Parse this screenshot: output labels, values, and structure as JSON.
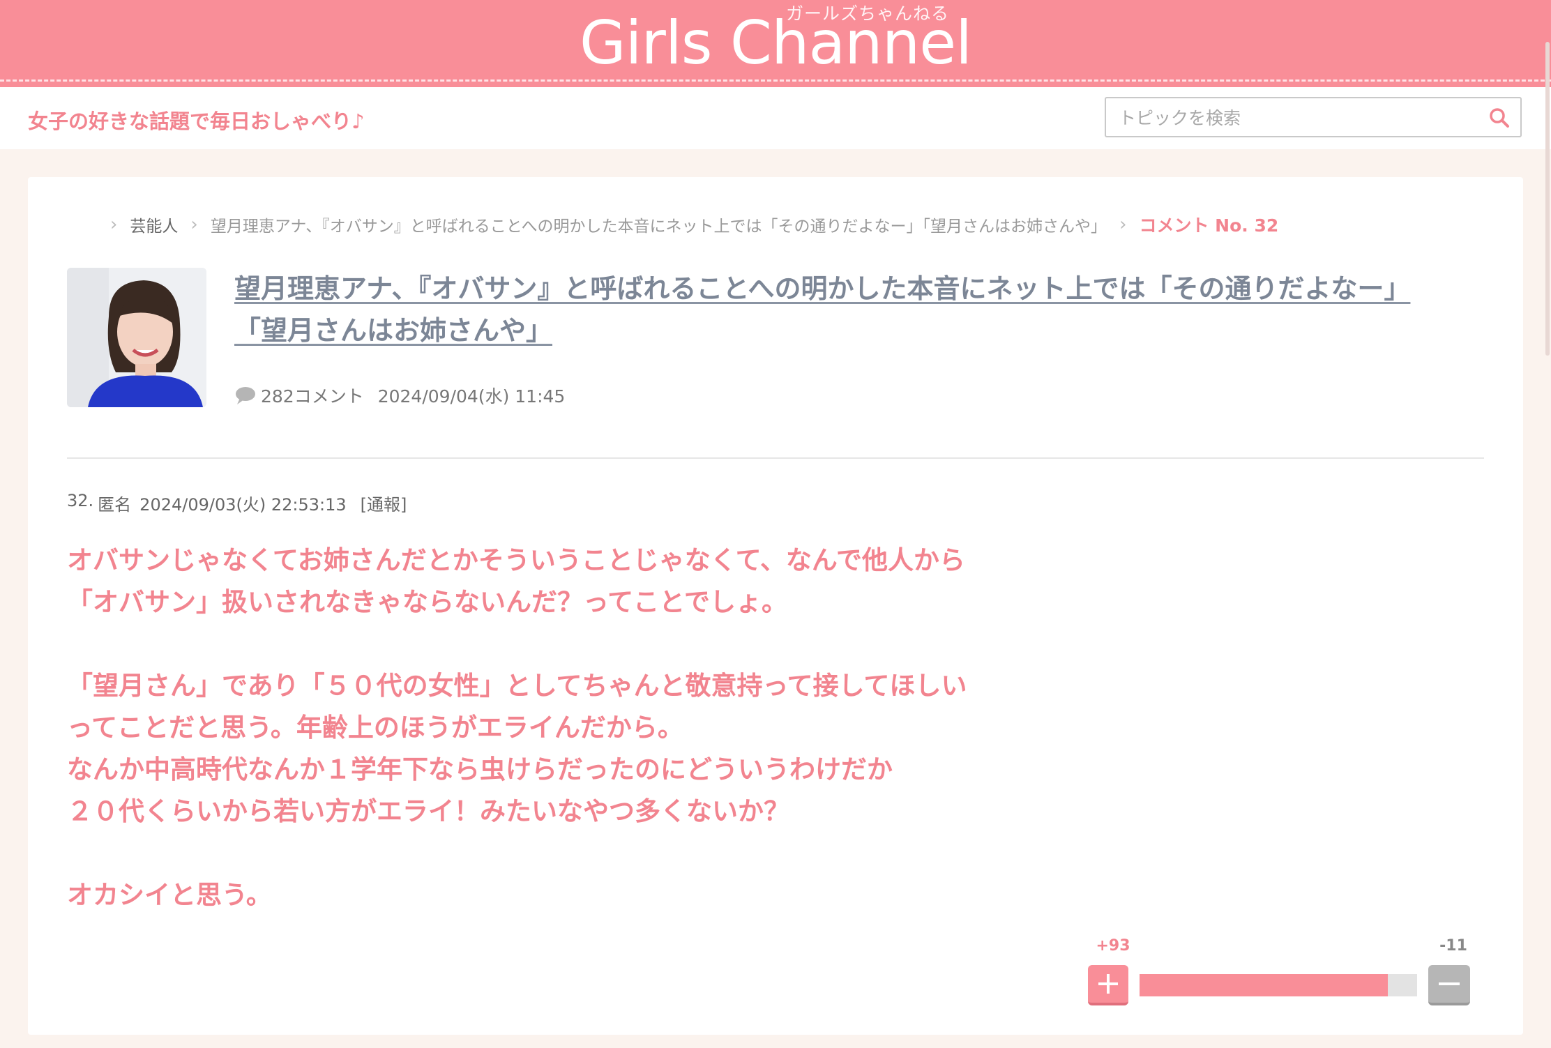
{
  "header": {
    "logo_text": "Girls Channel",
    "logo_ruby": "ガールズちゃんねる",
    "tagline": "女子の好きな話題で毎日おしゃべり♪",
    "search_placeholder": "トピックを検索"
  },
  "breadcrumb": {
    "items": [
      "芸能人",
      "望月理恵アナ、『オバサン』と呼ばれることへの明かした本音にネット上では「その通りだよなー」「望月さんはお姉さんや」",
      "コメント No. 32"
    ]
  },
  "topic": {
    "title": "望月理恵アナ、『オバサン』と呼ばれることへの明かした本音にネット上では「その通りだよなー」「望月さんはお姉さんや」",
    "comment_count": "282コメント",
    "date": "2024/09/04(水) 11:45"
  },
  "comment": {
    "number": "32.",
    "author": "匿名",
    "datetime": "2024/09/03(火) 22:53:13",
    "report_label": "[通報]",
    "lines": [
      "オバサンじゃなくてお姉さんだとかそういうことじゃなくて、なんで他人から",
      "「オバサン」扱いされなきゃならないんだ？ってことでしょ。",
      "",
      "「望月さん」であり「５０代の女性」としてちゃんと敬意持って接してほしい",
      "ってことだと思う。年齢上のほうがエライんだから。",
      "なんか中高時代なんか１学年下なら虫けらだったのにどういうわけだか",
      "２０代くらいから若い方がエライ！みたいなやつ多くないか？",
      "",
      "オカシイと思う。"
    ]
  },
  "votes": {
    "plus": "+93",
    "minus": "-11",
    "plus_ratio": 0.894
  },
  "colors": {
    "brand_pink": "#f98e98",
    "comment_text": "#f2848f",
    "title_text": "#7c8696"
  },
  "icons": {
    "search": "search-icon",
    "comment_bubble": "comment-bubble-icon",
    "chevron": "chevron-right-icon",
    "plus": "plus-icon",
    "minus": "minus-icon"
  }
}
